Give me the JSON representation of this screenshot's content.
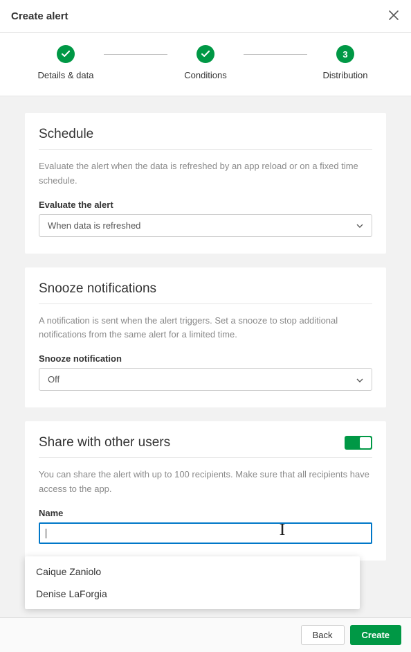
{
  "header": {
    "title": "Create alert"
  },
  "stepper": {
    "steps": [
      {
        "label": "Details & data",
        "state": "done"
      },
      {
        "label": "Conditions",
        "state": "done"
      },
      {
        "label": "Distribution",
        "state": "current",
        "num": "3"
      }
    ]
  },
  "schedule": {
    "title": "Schedule",
    "desc": "Evaluate the alert when the data is refreshed by an app reload or on a fixed time schedule.",
    "field_label": "Evaluate the alert",
    "select_value": "When data is refreshed"
  },
  "snooze": {
    "title": "Snooze notifications",
    "desc": "A notification is sent when the alert triggers. Set a snooze to stop additional notifications from the same alert for a limited time.",
    "field_label": "Snooze notification",
    "select_value": "Off"
  },
  "share": {
    "title": "Share with other users",
    "desc": "You can share the alert with up to 100 recipients. Make sure that all recipients have access to the app.",
    "field_label": "Name",
    "toggle_on": true,
    "suggestions": [
      "Caique Zaniolo",
      "Denise LaForgia"
    ]
  },
  "footer": {
    "back": "Back",
    "create": "Create"
  }
}
